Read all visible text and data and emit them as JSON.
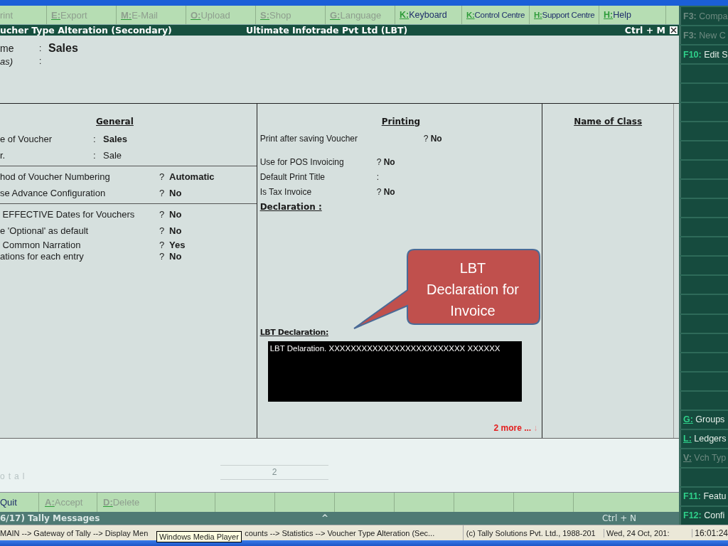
{
  "top_buttons": [
    {
      "label": "rint",
      "disabled": true
    },
    {
      "key": "E:",
      "label": "Export",
      "disabled": true
    },
    {
      "key": "M:",
      "label": "E-Mail",
      "disabled": true
    },
    {
      "key": "O:",
      "label": "Upload",
      "disabled": true
    },
    {
      "key": "S:",
      "label": "Shop",
      "disabled": true
    },
    {
      "key": "G:",
      "label": "Language",
      "disabled": true
    },
    {
      "key": "K:",
      "label": "Keyboard",
      "disabled": false
    },
    {
      "key": "K:",
      "label": "Control Centre",
      "disabled": false
    },
    {
      "key": "H:",
      "label": "Support Centre",
      "disabled": false
    },
    {
      "key": "H:",
      "label": "Help",
      "disabled": false
    }
  ],
  "title_bar": {
    "title": "ucher Type Alteration (Secondary)",
    "company": "Ultimate Infotrade Pvt Ltd (LBT)",
    "shortcut": "Ctrl + M"
  },
  "header": [
    {
      "label": "me",
      "sep": ":",
      "value": "Sales",
      "italic": false
    },
    {
      "label": "as)",
      "sep": ":",
      "italic": true
    }
  ],
  "general": {
    "title": "General",
    "sections": [
      [
        {
          "label": "e of Voucher",
          "sep": ":",
          "value": "Sales",
          "bold": true
        },
        {
          "label": "r.",
          "sep": ":",
          "value": "Sale",
          "bold": false
        }
      ],
      [
        {
          "label": "hod of Voucher Numbering",
          "sep": "?",
          "value": "Automatic",
          "bold": true
        },
        {
          "label": "se Advance Configuration",
          "sep": "?",
          "value": "No",
          "bold": true
        }
      ],
      [
        {
          "label": " EFFECTIVE Dates for Vouchers",
          "sep": "?",
          "value": "No",
          "bold": true
        },
        {
          "label": "e 'Optional' as default",
          "sep": "?",
          "value": "No",
          "bold": true
        },
        {
          "label": " Common Narration",
          "sep": "?",
          "value": "Yes",
          "bold": true
        },
        {
          "label": "ations for each entry",
          "sep": "?",
          "value": "No",
          "bold": true
        }
      ]
    ]
  },
  "printing": {
    "title": "Printing",
    "sections": [
      [
        {
          "label": "Print after saving Voucher",
          "sep": "?",
          "value": "No"
        }
      ],
      [
        {
          "label": "Use for POS Invoicing",
          "sep": "?",
          "value": "No"
        },
        {
          "label": "Default Print Title",
          "sep": ":"
        },
        {
          "label": "Is Tax Invoice",
          "sep": "?",
          "value": "No"
        }
      ]
    ],
    "declaration_label": "Declaration   :",
    "lbt_label": "LBT Declaration:",
    "lbt_text": "LBT Delaration. XXXXXXXXXXXXXXXXXXXXXXXXX XXXXXX",
    "more": "2 more ...",
    "more_arrow": "↓"
  },
  "class_column": {
    "title": "Name of Class"
  },
  "callout": {
    "lines": [
      "LBT",
      "Declaration for",
      "Invoice"
    ]
  },
  "total": {
    "label": "otal",
    "value": "2"
  },
  "bottom_buttons": [
    {
      "kind": "button",
      "label": "Quit",
      "disabled": false
    },
    {
      "kind": "button",
      "key": "A:",
      "label": "Accept",
      "disabled": true
    },
    {
      "kind": "button",
      "key": "D:",
      "label": "Delete",
      "disabled": true
    },
    {
      "kind": "blank"
    },
    {
      "kind": "blank"
    },
    {
      "kind": "blank"
    },
    {
      "kind": "blank"
    },
    {
      "kind": "blank"
    },
    {
      "kind": "blank"
    },
    {
      "kind": "blank"
    }
  ],
  "messages_bar": {
    "title": "6/17) Tally Messages",
    "caret": "^",
    "shortcut": "Ctrl + N"
  },
  "side_buttons": [
    {
      "kind": "button",
      "key": "F3:",
      "label": "Compa",
      "disabled": true
    },
    {
      "kind": "button",
      "key": "F3:",
      "label": "New C",
      "disabled": true
    },
    {
      "kind": "button",
      "key": "F10:",
      "label": "Edit S",
      "disabled": false
    },
    {
      "kind": "blank"
    },
    {
      "kind": "blank"
    },
    {
      "kind": "blank"
    },
    {
      "kind": "blank"
    },
    {
      "kind": "blank"
    },
    {
      "kind": "blank"
    },
    {
      "kind": "blank"
    },
    {
      "kind": "blank"
    },
    {
      "kind": "blank"
    },
    {
      "kind": "blank"
    },
    {
      "kind": "blank"
    },
    {
      "kind": "blank"
    },
    {
      "kind": "blank"
    },
    {
      "kind": "blank"
    },
    {
      "kind": "blank"
    },
    {
      "kind": "blank"
    },
    {
      "kind": "blank"
    },
    {
      "kind": "blank"
    },
    {
      "kind": "button",
      "key": "G:",
      "label": "Groups",
      "disabled": false
    },
    {
      "kind": "button",
      "key": "L:",
      "label": "Ledgers",
      "disabled": false
    },
    {
      "kind": "button",
      "key": "V:",
      "label": "Vch Typ",
      "disabled": true
    },
    {
      "kind": "blank"
    },
    {
      "kind": "button",
      "key": "F11:",
      "label": "Featu",
      "disabled": false
    },
    {
      "kind": "button",
      "key": "F12:",
      "label": "Confi",
      "disabled": false
    }
  ],
  "status_bar": {
    "path_start": "MAIN --> Gateway of Tally --> Display Men",
    "path_end": "counts --> Statistics --> Voucher Type Alteration (Sec...",
    "copyright": "(c) Tally Solutions Pvt. Ltd., 1988-201",
    "date": "Wed, 24 Oct, 201:",
    "time": "16:01:24"
  },
  "tooltip": "Windows Media Player"
}
